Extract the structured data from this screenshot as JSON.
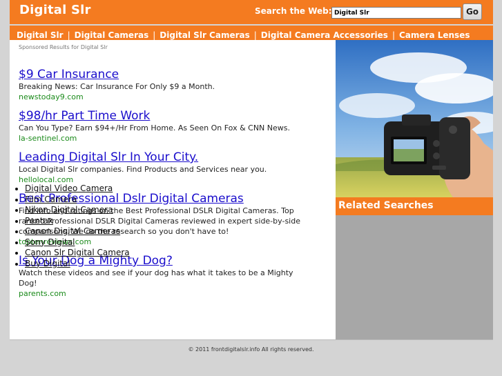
{
  "header": {
    "site_title": "Digital Slr",
    "search_label": "Search the Web:",
    "search_value": "Digital Slr",
    "go_label": "Go"
  },
  "nav": {
    "items": [
      {
        "label": "Digital Slr"
      },
      {
        "label": "Digital Cameras"
      },
      {
        "label": "Digital Slr Cameras"
      },
      {
        "label": "Digital Camera Accessories"
      },
      {
        "label": "Camera Lenses"
      }
    ],
    "separator": "|"
  },
  "sponsored_label": "Sponsored Results for Digital Slr",
  "ads": [
    {
      "title": "$9 Car Insurance",
      "description": "Breaking News: Car Insurance For Only $9 a Month.",
      "url": "newstoday9.com"
    },
    {
      "title": "$98/hr Part Time Work",
      "description": "Can You Type? Earn $94+/Hr From Home. As Seen On Fox & CNN News.",
      "url": "la-sentinel.com"
    },
    {
      "title": "Leading Digital Slr In Your City.",
      "description": "Local Digital Slr companies. Find Products and Services near you.",
      "url": "hellolocal.com"
    },
    {
      "title": "Best Professional Dslr Digital Cameras",
      "description": "Find info and ratings on the Best Professional DSLR Digital Cameras. Top ranked Professional DSLR Digital Cameras reviewed in expert side-by-side comparisons. We do the research so you don't have to!",
      "url": "toptenreviews.com"
    },
    {
      "title": "Is Your Dog a Mighty Dog?",
      "description": "Watch these videos and see if your dog has what it takes to be a Mighty Dog!",
      "url": "parents.com"
    }
  ],
  "related": {
    "title": "Related Searches",
    "items": [
      "Digital Video Camera",
      "Film Camera",
      "Nikon Digital Camera",
      "Pentax",
      "Canon Digital Cameras",
      "Sony Digital",
      "Canon Slr Digital Camera",
      "Buy Digital"
    ]
  },
  "footer": {
    "copyright": "© 2011 frontdigitalslr.info All rights reserved."
  },
  "colors": {
    "accent": "#f47b20",
    "link": "#1a0dcc",
    "url": "#1a8a1a",
    "page_bg": "#d4d4d4",
    "sidebar_bg": "#a7a7a7"
  }
}
